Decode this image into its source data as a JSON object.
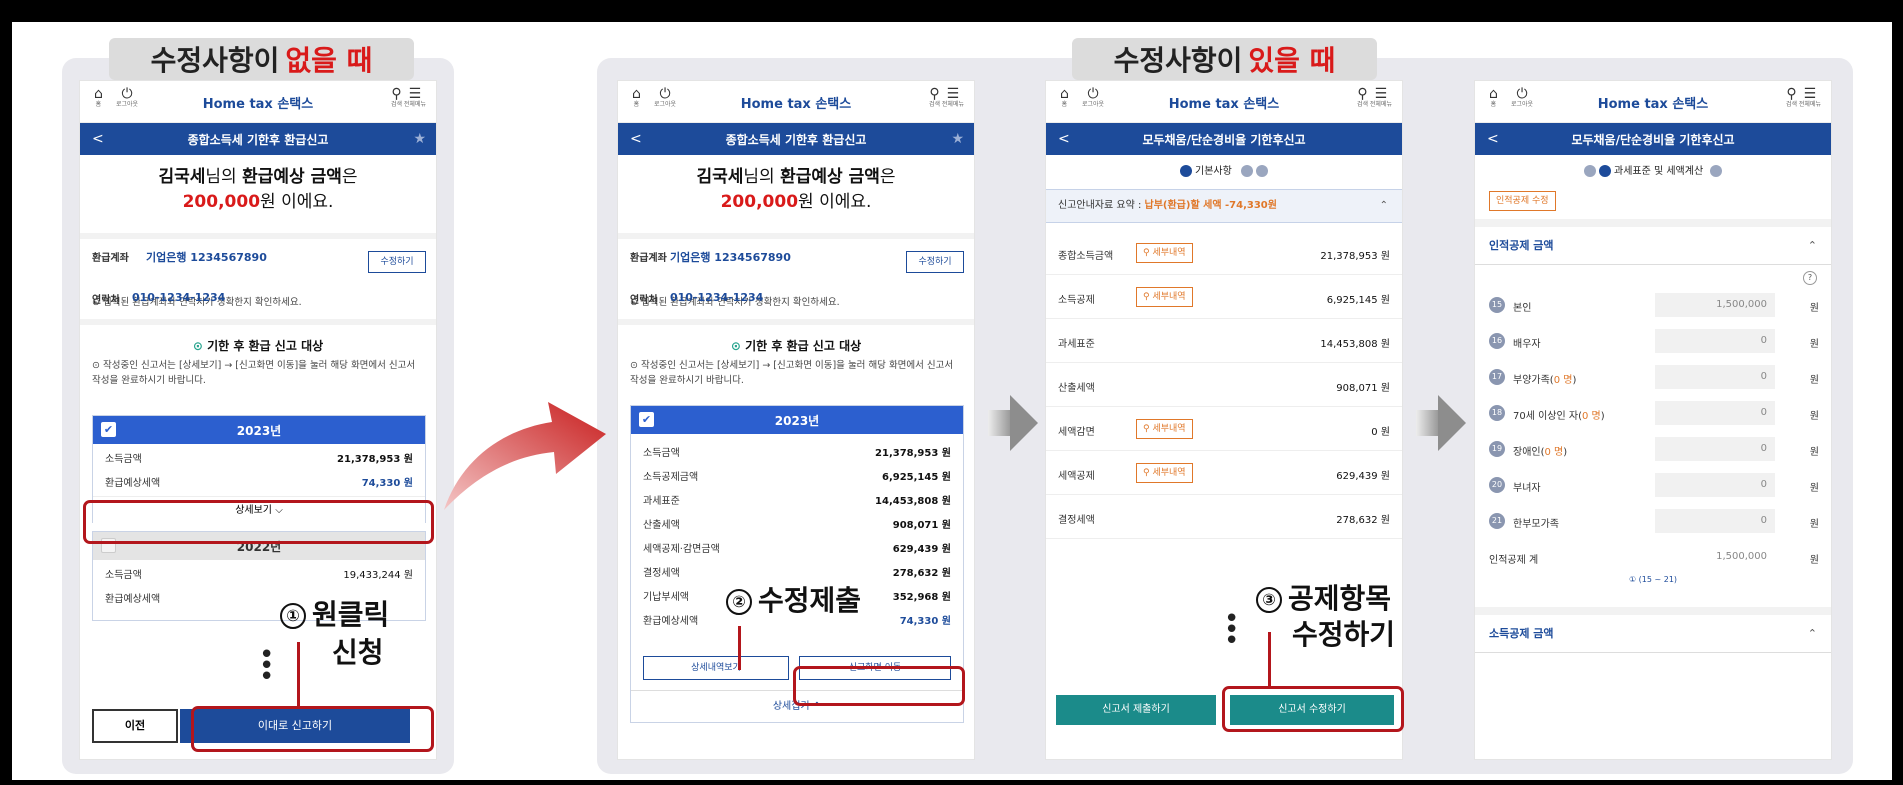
{
  "sections": {
    "no_changes": {
      "prefix": "수정사항이 ",
      "highlight": "없을 때"
    },
    "with_changes": {
      "prefix": "수정사항이 ",
      "highlight": "있을 때"
    }
  },
  "common": {
    "logo": "Home tax 손택스",
    "top_home": "홈",
    "top_logout": "로그아웃",
    "top_search": "검색",
    "top_menu": "전체메뉴"
  },
  "screen1": {
    "header": "종합소득세 기한후 환급신고",
    "name": "김국세",
    "greeting_mid": "님의 ",
    "greeting_bold": "환급예상 금액",
    "greeting_end": "은",
    "amount": "200,000",
    "amount_suffix": "원 이에요.",
    "account_label": "환급계좌",
    "account_value": "기업은행 1234567890",
    "contact_label": "연락처",
    "contact_value": "010-1234-1234",
    "edit_button": "수정하기",
    "notice": "⊙ 입력된 환급계좌와 연락처가 정확한지 확인하세요.",
    "target_title": "기한 후 환급 신고 대상",
    "target_desc": "⊙ 작성중인 신고서는 [상세보기] → [신고화면 이동]을 눌러 해당 화면에서 신고서 작성을 완료하시기 바랍니다.",
    "year1": "2023년",
    "y1_rows": [
      {
        "label": "소득금액",
        "value": "21,378,953 원"
      },
      {
        "label": "환급예상세액",
        "value": "74,330 원"
      }
    ],
    "details_button": "상세보기",
    "year2": "2022년",
    "y2_rows": [
      {
        "label": "소득금액",
        "value": "19,433,244 원"
      },
      {
        "label": "환급예상세액",
        "value": ""
      }
    ],
    "prev_button": "이전",
    "submit_button": "이대로 신고하기"
  },
  "screen2": {
    "header": "종합소득세 기한후 환급신고",
    "year1": "2023년",
    "rows": [
      {
        "label": "소득금액",
        "value": "21,378,953 원"
      },
      {
        "label": "소득공제금액",
        "value": "6,925,145 원"
      },
      {
        "label": "과세표준",
        "value": "14,453,808 원"
      },
      {
        "label": "산출세액",
        "value": "908,071 원"
      },
      {
        "label": "세액공제·감면금액",
        "value": "629,439 원"
      },
      {
        "label": "결정세액",
        "value": "278,632 원"
      },
      {
        "label": "기납부세액",
        "value": "352,968 원"
      },
      {
        "label": "환급예상세액",
        "value": "74,330 원"
      }
    ],
    "detail_history_button": "상세내역보기",
    "go_report_button": "신고화면 이동",
    "collapse_button": "상세접기"
  },
  "screen3": {
    "header": "모두채움/단순경비율 기한후신고",
    "step_label": "기본사항",
    "summary_prefix": "신고안내자료 요약 : ",
    "summary_value": "납부(환급)할 세액 -74,330원",
    "rows": [
      {
        "label": "종합소득금액",
        "tag": "세부내역",
        "value": "21,378,953 원"
      },
      {
        "label": "소득공제",
        "tag": "세부내역",
        "value": "6,925,145 원"
      },
      {
        "label": "과세표준",
        "tag": "",
        "value": "14,453,808 원"
      },
      {
        "label": "산출세액",
        "tag": "",
        "value": "908,071 원"
      },
      {
        "label": "세액감면",
        "tag": "세부내역",
        "value": "0 원"
      },
      {
        "label": "세액공제",
        "tag": "세부내역",
        "value": "629,439 원"
      },
      {
        "label": "결정세액",
        "tag": "",
        "value": "278,632 원"
      }
    ],
    "submit_button": "신고서 제출하기",
    "edit_button": "신고서 수정하기"
  },
  "screen4": {
    "header": "모두채움/단순경비율 기한후신고",
    "step_label": "과세표준 및 세액계산",
    "edit_tag": "인적공제 수정",
    "section_title": "인적공제 금액",
    "items": [
      {
        "num": "15",
        "label": "본인",
        "value": "1,500,000"
      },
      {
        "num": "16",
        "label": "배우자",
        "value": "0"
      },
      {
        "num": "17",
        "label": "부양가족(",
        "count": "0 명",
        "close": ")",
        "value": "0"
      },
      {
        "num": "18",
        "label": "70세 이상인 자(",
        "count": "0 명",
        "close": ")",
        "value": "0"
      },
      {
        "num": "19",
        "label": "장애인(",
        "count": "0 명",
        "close": ")",
        "value": "0"
      },
      {
        "num": "20",
        "label": "부녀자",
        "value": "0"
      },
      {
        "num": "21",
        "label": "한부모가족",
        "value": "0"
      }
    ],
    "unit": "원",
    "total_label": "인적공제 계",
    "total_value": "1,500,000",
    "total_note": "① (15 ~ 21)",
    "section2_title": "소득공제 금액"
  },
  "annotations": {
    "a1_num": "①",
    "a1_line1": "원클릭",
    "a1_line2": "신청",
    "a2_num": "②",
    "a2_text": "수정제출",
    "a3_num": "③",
    "a3_line1": "공제항목",
    "a3_line2": "수정하기"
  },
  "colors": {
    "brand": "#1d4b9a",
    "card_header": "#2c5fcf",
    "highlight": "#d91a1a",
    "teal": "#1b8b8a",
    "tag": "#e0782a"
  }
}
